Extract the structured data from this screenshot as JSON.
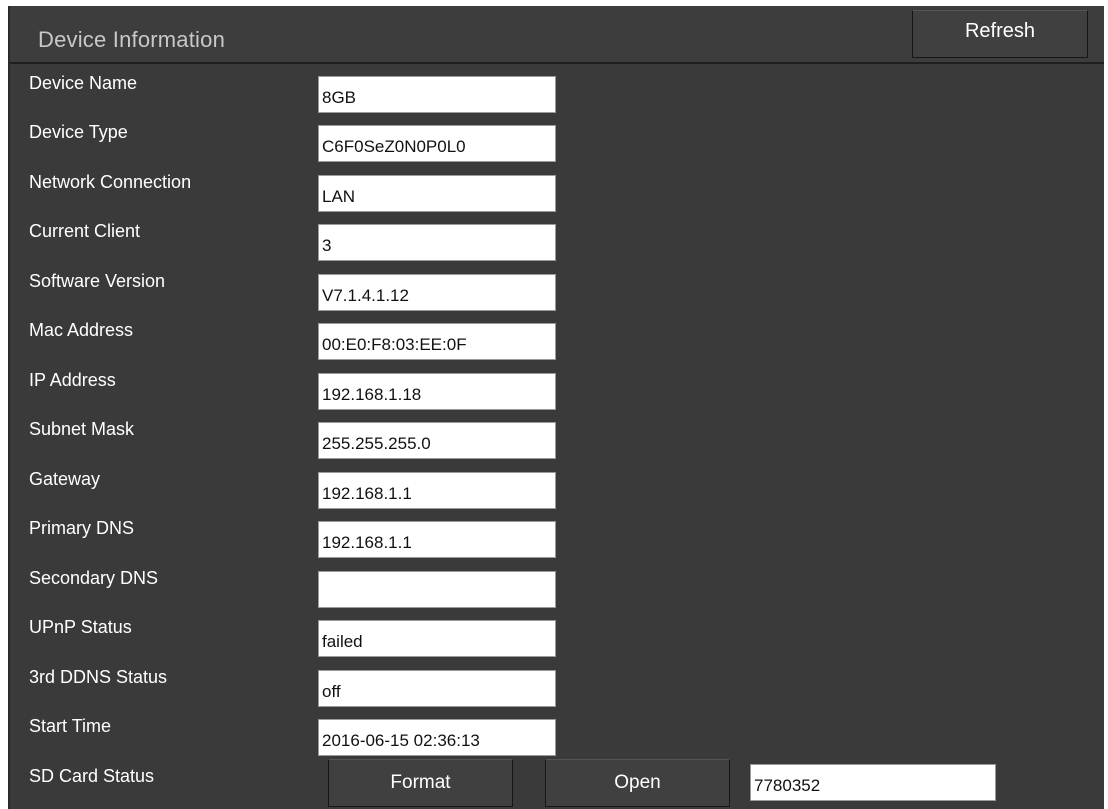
{
  "header": {
    "title": "Device Information",
    "refresh_label": "Refresh"
  },
  "rows": [
    {
      "label": "Device Name",
      "value": "8GB"
    },
    {
      "label": "Device Type",
      "value": "C6F0SeZ0N0P0L0"
    },
    {
      "label": "Network Connection",
      "value": "LAN"
    },
    {
      "label": "Current Client",
      "value": "3"
    },
    {
      "label": "Software Version",
      "value": "V7.1.4.1.12"
    },
    {
      "label": "Mac Address",
      "value": "00:E0:F8:03:EE:0F"
    },
    {
      "label": "IP Address",
      "value": "192.168.1.18"
    },
    {
      "label": "Subnet Mask",
      "value": "255.255.255.0"
    },
    {
      "label": "Gateway",
      "value": "192.168.1.1"
    },
    {
      "label": "Primary DNS",
      "value": "192.168.1.1"
    },
    {
      "label": "Secondary DNS",
      "value": ""
    },
    {
      "label": "UPnP Status",
      "value": "failed"
    },
    {
      "label": "3rd DDNS Status",
      "value": "off"
    },
    {
      "label": "Start Time",
      "value": "2016-06-15 02:36:13"
    }
  ],
  "sd_card": {
    "label": "SD Card Status",
    "format_label": "Format",
    "open_label": "Open",
    "value": "7780352"
  }
}
